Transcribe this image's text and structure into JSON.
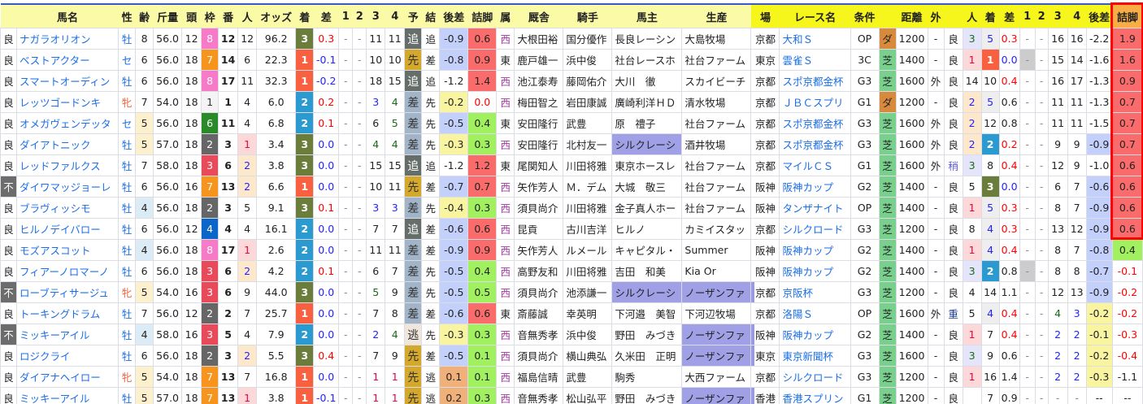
{
  "headers": [
    "",
    "馬名",
    "性",
    "齢",
    "斤量",
    "頭",
    "枠",
    "番",
    "人",
    "オッズ",
    "着",
    "差",
    "1",
    "2",
    "3",
    "4",
    "予",
    "結",
    "後差",
    "詰脚",
    "属",
    "厩舎",
    "騎手",
    "馬主",
    "生産",
    "場",
    "レース名",
    "条件",
    "",
    "距離",
    "外",
    "",
    "人",
    "着",
    "差",
    "1",
    "2",
    "3",
    "4",
    "後差",
    "詰脚"
  ],
  "rows": [
    [
      "良",
      "ナガラオリオン",
      "牡",
      "8",
      "56.0",
      "12",
      "8",
      "12",
      "12",
      "96.2",
      "3",
      "0.3",
      "-",
      "-",
      "11",
      "11",
      "追",
      "追",
      "-0.9",
      "0.6",
      "西",
      "大根田裕",
      "国分優作",
      "長良レーシン",
      "大島牧場",
      "京都",
      "大和Ｓ",
      "OP",
      "ダ",
      "1200",
      "-",
      "良",
      "3",
      "5",
      "0.3",
      "-",
      "-",
      "16",
      "16",
      "-2.2",
      "1.9"
    ],
    [
      "良",
      "ベストアクター",
      "セ",
      "6",
      "56.0",
      "18",
      "7",
      "14",
      "6",
      "22.3",
      "1",
      "-0.1",
      "-",
      "-",
      "10",
      "10",
      "先",
      "差",
      "-0.8",
      "0.9",
      "東",
      "鹿戸雄一",
      "浜中俊",
      "社台レースホ",
      "社台ファーム",
      "東京",
      "雲雀Ｓ",
      "3C",
      "芝",
      "1400",
      "-",
      "良",
      "1",
      "1",
      "0.0",
      "-",
      "-",
      "15",
      "14",
      "-1.6",
      "1.6"
    ],
    [
      "良",
      "スマートオーディン",
      "牡",
      "6",
      "56.0",
      "18",
      "8",
      "17",
      "11",
      "32.3",
      "1",
      "-0.2",
      "-",
      "-",
      "18",
      "15",
      "追",
      "追",
      "-1.2",
      "1.4",
      "西",
      "池江泰寿",
      "藤岡佑介",
      "大川　徹",
      "スカイビーチ",
      "京都",
      "スポ京都金杯",
      "G3",
      "芝",
      "1600",
      "外",
      "良",
      "14",
      "10",
      "0.4",
      "-",
      "-",
      "16",
      "17",
      "-1.3",
      "0.9"
    ],
    [
      "良",
      "レッツゴードンキ",
      "牝",
      "7",
      "54.0",
      "18",
      "1",
      "1",
      "4",
      "6.0",
      "2",
      "0.2",
      "-",
      "-",
      "3",
      "4",
      "差",
      "先",
      "-0.2",
      "0.0",
      "西",
      "梅田智之",
      "岩田康誠",
      "廣崎利洋ＨＤ",
      "清水牧場",
      "京都",
      "ＪＢＣスプリ",
      "G1",
      "ダ",
      "1200",
      "-",
      "良",
      "2",
      "5",
      "0.6",
      "-",
      "-",
      "11",
      "11",
      "-1.3",
      "0.7"
    ],
    [
      "良",
      "オメガヴェンデッタ",
      "セ",
      "5",
      "56.0",
      "18",
      "6",
      "11",
      "4",
      "6.8",
      "2",
      "0.1",
      "-",
      "-",
      "6",
      "5",
      "差",
      "先",
      "-0.5",
      "0.4",
      "東",
      "安田隆行",
      "武豊",
      "原　禮子",
      "社台ファーム",
      "京都",
      "スポ京都金杯",
      "G3",
      "芝",
      "1600",
      "外",
      "良",
      "2",
      "12",
      "0.8",
      "-",
      "-",
      "11",
      "11",
      "-1.5",
      "0.7"
    ],
    [
      "良",
      "ダイアトニック",
      "牡",
      "5",
      "57.0",
      "18",
      "2",
      "3",
      "1",
      "3.4",
      "3",
      "0.0",
      "-",
      "-",
      "4",
      "4",
      "差",
      "先",
      "-0.3",
      "0.3",
      "西",
      "安田隆行",
      "北村友一",
      "シルクレーシ",
      "酒井牧場",
      "京都",
      "スポ京都金杯",
      "G3",
      "芝",
      "1600",
      "外",
      "良",
      "2",
      "2",
      "0.2",
      "-",
      "-",
      "9",
      "9",
      "-0.9",
      "0.7"
    ],
    [
      "良",
      "レッドファルクス",
      "牡",
      "7",
      "58.0",
      "18",
      "3",
      "6",
      "2",
      "3.8",
      "3",
      "0.0",
      "-",
      "-",
      "15",
      "15",
      "追",
      "追",
      "-1.2",
      "1.2",
      "東",
      "尾関知人",
      "川田将雅",
      "東京ホースレ",
      "社台ファーム",
      "京都",
      "マイルＣＳ",
      "G1",
      "芝",
      "1600",
      "外",
      "稍",
      "3",
      "8",
      "0.4",
      "-",
      "-",
      "12",
      "9",
      "-1.0",
      "0.6"
    ],
    [
      "不",
      "ダイワマッジョーレ",
      "牡",
      "6",
      "56.0",
      "16",
      "7",
      "13",
      "2",
      "6.6",
      "1",
      "0.0",
      "-",
      "-",
      "10",
      "11",
      "先",
      "差",
      "-0.7",
      "0.7",
      "西",
      "矢作芳人",
      "Ｍ．デム",
      "大城　敬三",
      "社台ファーム",
      "阪神",
      "阪神カップ",
      "G2",
      "芝",
      "1400",
      "-",
      "良",
      "5",
      "3",
      "0.0",
      "-",
      "-",
      "6",
      "7",
      "-0.6",
      "0.6"
    ],
    [
      "良",
      "ブラヴィッシモ",
      "牡",
      "4",
      "56.0",
      "18",
      "2",
      "3",
      "5",
      "9.1",
      "3",
      "0.1",
      "-",
      "-",
      "3",
      "3",
      "差",
      "先",
      "-0.4",
      "0.3",
      "西",
      "須貝尚介",
      "川田将雅",
      "金子真人ホー",
      "社台ファーム",
      "阪神",
      "タンザナイト",
      "OP",
      "芝",
      "1400",
      "-",
      "良",
      "1",
      "5",
      "0.3",
      "-",
      "-",
      "8",
      "7",
      "-0.9",
      "0.6"
    ],
    [
      "良",
      "ヒルノデイバロー",
      "牡",
      "6",
      "56.0",
      "12",
      "4",
      "4",
      "4",
      "16.1",
      "2",
      "0.0",
      "-",
      "-",
      "7",
      "7",
      "追",
      "差",
      "-0.6",
      "0.6",
      "西",
      "昆貢",
      "古川吉洋",
      "ヒルノ",
      "カミイスタッ",
      "京都",
      "シルクロード",
      "G3",
      "芝",
      "1200",
      "-",
      "良",
      "8",
      "4",
      "0.3",
      "-",
      "-",
      "13",
      "12",
      "-0.9",
      "0.6"
    ],
    [
      "良",
      "モズアスコット",
      "牡",
      "4",
      "56.0",
      "18",
      "8",
      "17",
      "1",
      "2.6",
      "2",
      "0.0",
      "-",
      "-",
      "11",
      "11",
      "差",
      "差",
      "-0.9",
      "0.9",
      "西",
      "矢作芳人",
      "ルメール",
      "キャピタル・",
      "Summer",
      "阪神",
      "阪神カップ",
      "G2",
      "芝",
      "1400",
      "-",
      "良",
      "1",
      "4",
      "0.4",
      "-",
      "-",
      "8",
      "7",
      "-0.8",
      "0.4"
    ],
    [
      "良",
      "フィアーノロマーノ",
      "牡",
      "6",
      "56.0",
      "18",
      "3",
      "6",
      "2",
      "4.2",
      "2",
      "0.1",
      "-",
      "-",
      "6",
      "7",
      "差",
      "先",
      "-0.5",
      "0.4",
      "西",
      "高野友和",
      "川田将雅",
      "吉田　和美",
      "Kia Or",
      "阪神",
      "阪神カップ",
      "G2",
      "芝",
      "1400",
      "-",
      "良",
      "3",
      "2",
      "0.8",
      "-",
      "-",
      "8",
      "8",
      "-0.7",
      "-0.1"
    ],
    [
      "不",
      "ローブティサージュ",
      "牝",
      "5",
      "54.0",
      "16",
      "3",
      "6",
      "9",
      "44.0",
      "3",
      "0.0",
      "-",
      "-",
      "5",
      "9",
      "差",
      "先",
      "-0.5",
      "0.5",
      "西",
      "須貝尚介",
      "池添謙一",
      "シルクレーシ",
      "ノーザンファ",
      "京都",
      "京阪杯",
      "G3",
      "芝",
      "1200",
      "-",
      "良",
      "4",
      "14",
      "1.1",
      "-",
      "-",
      "12",
      "13",
      "-0.9",
      "-0.2"
    ],
    [
      "良",
      "トーキングドラム",
      "牡",
      "7",
      "56.0",
      "12",
      "2",
      "2",
      "7",
      "25.7",
      "1",
      "0.0",
      "-",
      "-",
      "7",
      "8",
      "差",
      "差",
      "-0.6",
      "0.6",
      "東",
      "斎藤誠",
      "幸英明",
      "下河邉　美智",
      "下河辺牧場",
      "京都",
      "洛陽Ｓ",
      "OP",
      "芝",
      "1600",
      "外",
      "重",
      "5",
      "4",
      "0.4",
      "-",
      "-",
      "4",
      "3",
      "-0.2",
      "-0.2"
    ],
    [
      "不",
      "ミッキーアイル",
      "牡",
      "4",
      "58.0",
      "16",
      "3",
      "5",
      "4",
      "7.9",
      "2",
      "0.0",
      "-",
      "-",
      "2",
      "4",
      "逃",
      "先",
      "-0.3",
      "0.3",
      "西",
      "音無秀孝",
      "浜中俊",
      "野田　みづき",
      "ノーザンファ",
      "阪神",
      "阪神カップ",
      "G2",
      "芝",
      "1400",
      "-",
      "良",
      "1",
      "7",
      "0.4",
      "-",
      "-",
      "2",
      "2",
      "-0.1",
      "-0.3"
    ],
    [
      "良",
      "ロジクライ",
      "牡",
      "6",
      "56.0",
      "18",
      "2",
      "3",
      "2",
      "5.5",
      "3",
      "0.4",
      "-",
      "-",
      "7",
      "9",
      "先",
      "差",
      "-0.5",
      "0.1",
      "西",
      "須貝尚介",
      "横山典弘",
      "久米田　正明",
      "ノーザンファ",
      "東京",
      "東京新聞杯",
      "G3",
      "芝",
      "1600",
      "-",
      "良",
      "3",
      "9",
      "0.6",
      "-",
      "-",
      "2",
      "2",
      "-0.2",
      "-0.4"
    ],
    [
      "良",
      "ダイアナヘイロー",
      "牝",
      "5",
      "54.0",
      "18",
      "7",
      "13",
      "7",
      "16.8",
      "1",
      "0.0",
      "-",
      "-",
      "1",
      "1",
      "先",
      "逃",
      "0.1",
      "0.1",
      "西",
      "福島信晴",
      "武豊",
      "駒秀",
      "大西ファーム",
      "京都",
      "シルクロード",
      "G3",
      "芝",
      "1200",
      "-",
      "良",
      "1",
      "16",
      "1.4",
      "-",
      "-",
      "2",
      "2",
      "-0.3",
      "-1.1"
    ],
    [
      "良",
      "ミッキーアイル",
      "牡",
      "5",
      "57.0",
      "18",
      "7",
      "13",
      "1",
      "3.8",
      "1",
      "-0.1",
      "-",
      "-",
      "1",
      "1",
      "先",
      "逃",
      "0.2",
      "0.3",
      "西",
      "音無秀孝",
      "松山弘平",
      "野田　みづき",
      "ノーザンファ",
      "香港",
      "香港スプリン",
      "G1",
      "芝",
      "1200",
      "-",
      "良",
      "",
      "7",
      "0.9",
      "-",
      "-",
      "-",
      "-",
      "--",
      "--"
    ]
  ],
  "colors": {
    "accent_border": "#ff0000",
    "header_yellow": "#f6f61c",
    "header_light": "#fbfaa6",
    "link": "#1a6ee8"
  }
}
